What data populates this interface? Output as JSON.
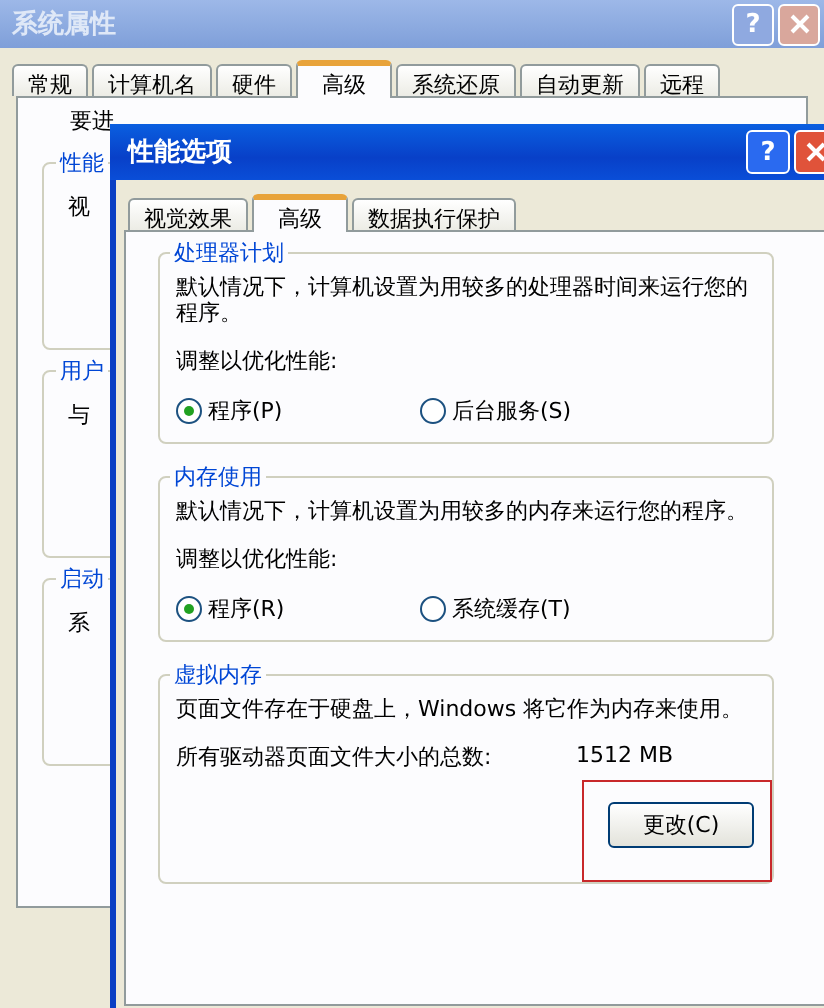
{
  "back_window": {
    "title": "系统属性",
    "help": "?",
    "tabs": [
      {
        "label": "常规",
        "selected": false
      },
      {
        "label": "计算机名",
        "selected": false
      },
      {
        "label": "硬件",
        "selected": false
      },
      {
        "label": "高级",
        "selected": true
      },
      {
        "label": "系统还原",
        "selected": false
      },
      {
        "label": "自动更新",
        "selected": false
      },
      {
        "label": "远程",
        "selected": false
      }
    ],
    "notice": "要进",
    "groups": [
      {
        "title": "性能",
        "text": "视"
      },
      {
        "title": "用户",
        "text": "与"
      },
      {
        "title": "启动",
        "text": "系"
      }
    ]
  },
  "dialog": {
    "title": "性能选项",
    "help": "?",
    "tabs": [
      {
        "label": "视觉效果",
        "selected": false
      },
      {
        "label": "高级",
        "selected": true
      },
      {
        "label": "数据执行保护",
        "selected": false
      }
    ],
    "groups": [
      {
        "kind": "radios",
        "title": "处理器计划",
        "text": "默认情况下，计算机设置为用较多的处理器时间来运行您的程序。",
        "prompt": "调整以优化性能:",
        "options": [
          {
            "label": "程序(P)",
            "selected": true
          },
          {
            "label": "后台服务(S)",
            "selected": false
          }
        ]
      },
      {
        "kind": "radios",
        "title": "内存使用",
        "text": "默认情况下，计算机设置为用较多的内存来运行您的程序。",
        "prompt": "调整以优化性能:",
        "options": [
          {
            "label": "程序(R)",
            "selected": true
          },
          {
            "label": "系统缓存(T)",
            "selected": false
          }
        ]
      },
      {
        "kind": "pagefile",
        "title": "虚拟内存",
        "text": "页面文件存在于硬盘上，Windows 将它作为内存来使用。",
        "total_label": "所有驱动器页面文件大小的总数:",
        "total_value": "1512 MB",
        "button": {
          "label": "更改(C)",
          "highlighted": true
        }
      }
    ]
  }
}
